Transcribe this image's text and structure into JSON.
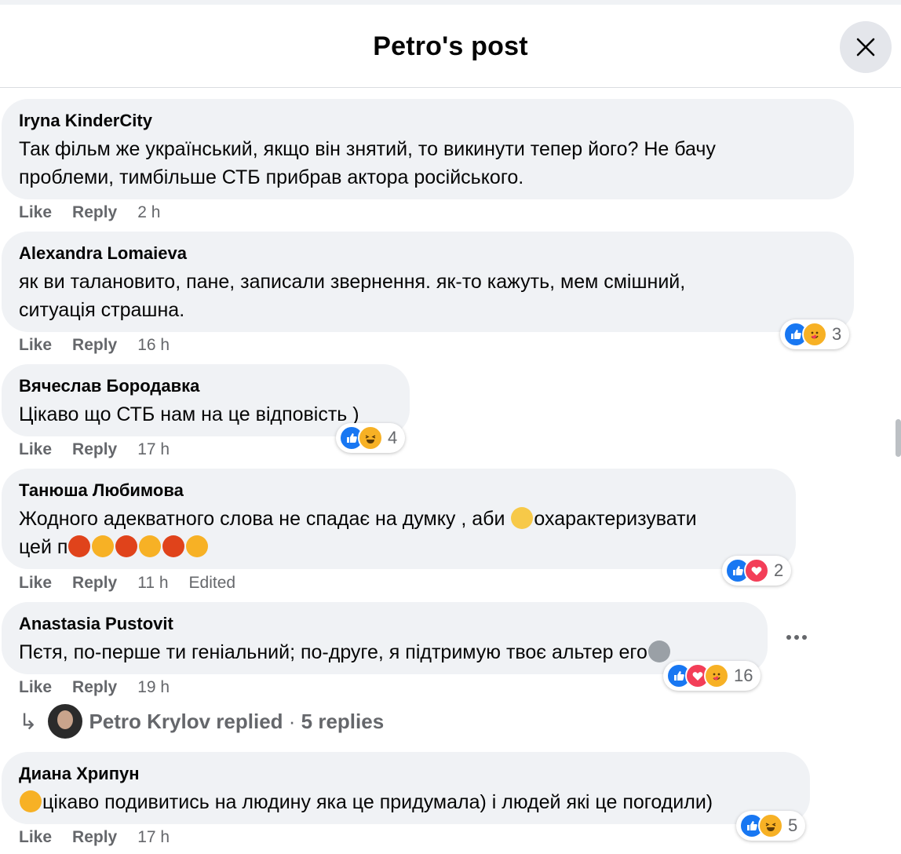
{
  "header": {
    "title": "Petro's post"
  },
  "actions": {
    "like": "Like",
    "reply": "Reply"
  },
  "comments": [
    {
      "author": "Iryna KinderCity",
      "lines": [
        "Так фільм же український, якщо він знятий, то викинути тепер його? Не бачу",
        "проблеми, тимбільше СТБ прибрав актора російського."
      ],
      "time": "2 h"
    },
    {
      "author": "Alexandra Lomaieva",
      "lines": [
        "як ви талановито, пане, записали звернення. як-то кажуть, мем смішний,",
        "ситуація страшна."
      ],
      "time": "16 h",
      "reaction_count": "3",
      "reactions": [
        "like-icon",
        "care-icon"
      ]
    },
    {
      "author": "Вячеслав Бородавка",
      "lines": [
        "Цікаво що СТБ нам на це відповість )"
      ],
      "time": "17 h",
      "reaction_count": "4",
      "reactions": [
        "like-icon",
        "haha-icon"
      ]
    },
    {
      "author": "Танюша Любимова",
      "line1_a": "Жодного адекватного слова не спадає на думку , аби ",
      "line1_b": "охарактеризувати",
      "line2_a": "цей п",
      "time": "11 h",
      "edited": "Edited",
      "reaction_count": "2",
      "reactions": [
        "like-icon",
        "love-icon"
      ]
    },
    {
      "author": "Anastasia Pustovit",
      "line1_a": "Пєтя, по-перше ти геніальний; по-друге, я підтримую твоє альтер его",
      "time": "19 h",
      "reaction_count": "16",
      "reactions": [
        "like-icon",
        "love-icon",
        "care-icon"
      ]
    },
    {
      "author": "Диана Хрипун",
      "line1_a": "цікаво подивитись на людину яка це придумала) і людей які це погодили)",
      "time": "17 h",
      "reaction_count": "5",
      "reactions": [
        "like-icon",
        "haha-icon"
      ]
    }
  ],
  "replied": {
    "name": "Petro Krylov replied",
    "sep": " · ",
    "count": "5 replies"
  },
  "colors": {
    "bubble": "#f0f2f5",
    "like": "#1877f2",
    "love": "#f33e58",
    "care": "#f7b125",
    "muted": "#65676b"
  }
}
